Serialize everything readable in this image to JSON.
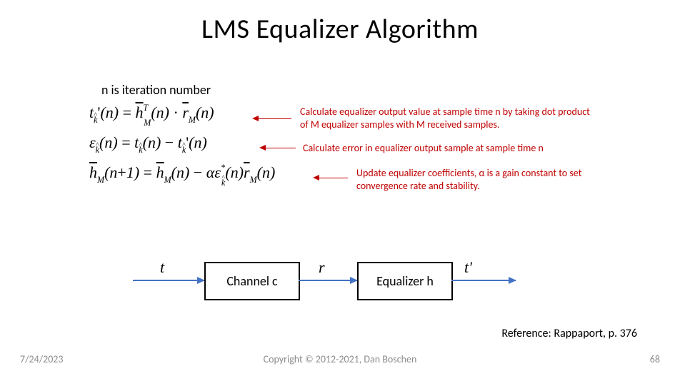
{
  "title": "LMS Equalizer Algorithm",
  "subtitle": "n is iteration number",
  "notes": {
    "output": "Calculate equalizer output value at sample time n by taking dot product of M equalizer samples with M received samples.",
    "error": "Calculate error in equalizer output sample at sample time n",
    "update": "Update equalizer coefficients, α is a gain constant to set convergence rate and stability."
  },
  "diagram": {
    "signal_in": "t",
    "block_channel": "Channel c",
    "signal_mid": "r",
    "block_equalizer": "Equalizer h",
    "signal_out": "t'"
  },
  "reference": "Reference: Rappaport, p. 376",
  "footer": {
    "date": "7/24/2023",
    "copyright": "Copyright © 2012-2021, Dan Boschen",
    "page": "68"
  }
}
